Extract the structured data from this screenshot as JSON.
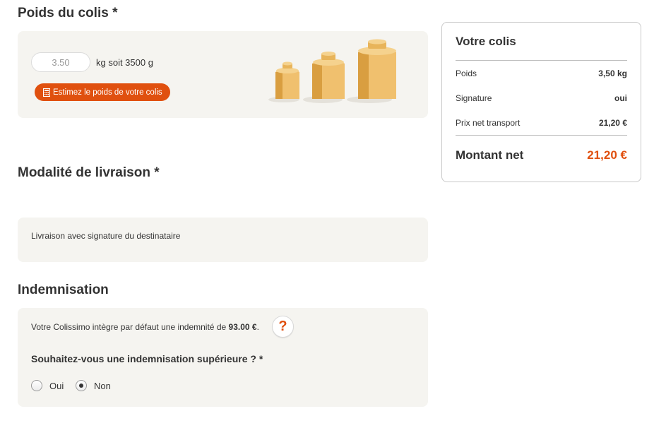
{
  "weight_section": {
    "title": "Poids du colis *",
    "input_value": "3.50",
    "weight_text": "kg soit 3500 g",
    "estimate_button": "Estimez le poids de votre colis"
  },
  "delivery_section": {
    "title": "Modalité de livraison *",
    "option_text": "Livraison avec signature du destinataire"
  },
  "indemnity_section": {
    "title": "Indemnisation",
    "info_prefix": "Votre Colissimo intègre par défaut une indemnité de",
    "info_amount": "93.00 €",
    "info_suffix": ".",
    "help_label": "?",
    "question": "Souhaitez-vous une indemnisation supérieure ? *",
    "option_yes": "Oui",
    "option_no": "Non",
    "selected": "Non"
  },
  "summary": {
    "title": "Votre colis",
    "rows": [
      {
        "label": "Poids",
        "value": "3,50 kg"
      },
      {
        "label": "Signature",
        "value": "oui"
      },
      {
        "label": "Prix net transport",
        "value": "21,20 €"
      }
    ],
    "total_label": "Montant net",
    "total_value": "21,20 €"
  },
  "colors": {
    "accent": "#e0500f",
    "panel": "#f5f4f0",
    "weight_light": "#f0c06e",
    "weight_dark": "#d99e40"
  },
  "icons": [
    "calculator-icon",
    "weights-illustration",
    "help-icon"
  ]
}
